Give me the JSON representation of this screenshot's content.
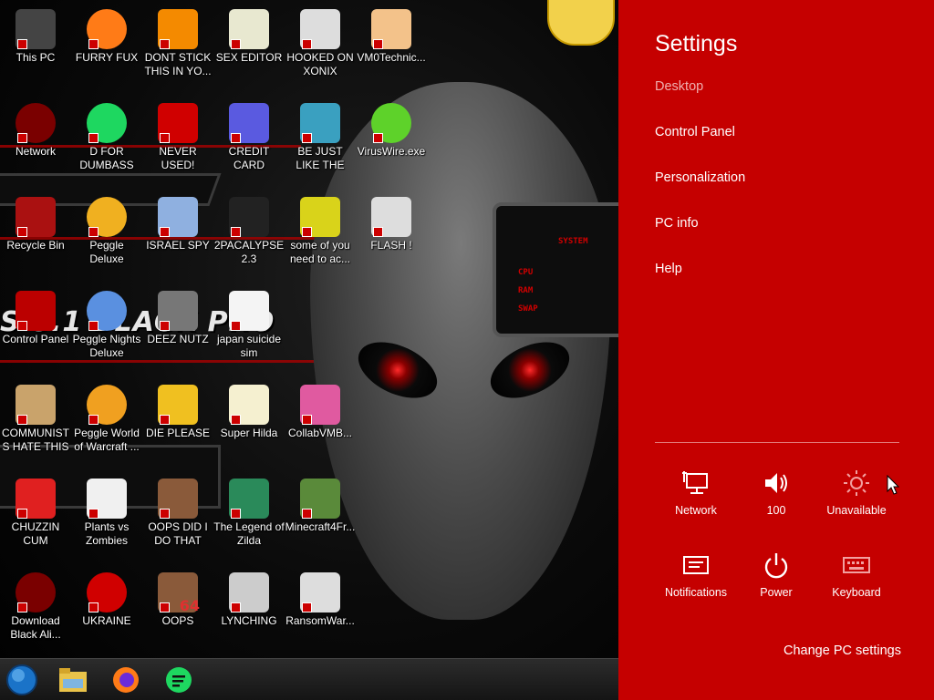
{
  "desktop": {
    "wallpaper_text": "S 8.1 BLACK PRO",
    "system_panel": {
      "title": "SYSTEM",
      "rows": [
        "CPU",
        "RAM",
        "SWAP"
      ]
    },
    "icons": [
      {
        "label": "This PC",
        "icon": "computer-icon"
      },
      {
        "label": "FURRY FUX",
        "icon": "firefox-icon"
      },
      {
        "label": "DONT STICK THIS IN YO...",
        "icon": "vlc-cone-icon"
      },
      {
        "label": "SEX EDITOR",
        "icon": "hex-editor-icon"
      },
      {
        "label": "HOOKED ON XONIX",
        "icon": "xonix-game-icon"
      },
      {
        "label": "VM0Technic...",
        "icon": "doctor-avatar-icon"
      },
      {
        "label": "Network",
        "icon": "network-orb-icon"
      },
      {
        "label": "D FOR DUMBASS",
        "icon": "spotify-icon"
      },
      {
        "label": "NEVER USED!",
        "icon": "devcpp-icon"
      },
      {
        "label": "CREDIT CARD CHECKER",
        "icon": "credit-card-icon"
      },
      {
        "label": "BE JUST LIKE THE DUDE!",
        "icon": "santa-dude-icon"
      },
      {
        "label": "VirusWire.exe",
        "icon": "limewire-icon"
      },
      {
        "label": "Recycle Bin",
        "icon": "recycle-bin-icon"
      },
      {
        "label": "Peggle Deluxe",
        "icon": "peggle-icon"
      },
      {
        "label": "ISRAEL SPY",
        "icon": "spy-program-icon"
      },
      {
        "label": "2PACALYPSE 2.3",
        "icon": "cmd-prompt-icon"
      },
      {
        "label": "some of you need to ac...",
        "icon": "dog-image-icon"
      },
      {
        "label": "FLASH !",
        "icon": "flash-icon"
      },
      {
        "label": "Control Panel",
        "icon": "control-panel-icon"
      },
      {
        "label": "Peggle Nights Deluxe",
        "icon": "peggle-nights-icon"
      },
      {
        "label": "DEEZ NUTZ",
        "icon": "stacked-windows-icon"
      },
      {
        "label": "japan suicide sim",
        "icon": "game-file-icon"
      },
      {
        "label": "COMMUNISTS HATE THIS G...",
        "icon": "money-bag-icon"
      },
      {
        "label": "Peggle World of Warcraft ...",
        "icon": "peggle-wow-icon"
      },
      {
        "label": "DIE PLEASE",
        "icon": "de-app-icon"
      },
      {
        "label": "Super Hilda",
        "icon": "pixel-game-icon"
      },
      {
        "label": "CollabVMB...",
        "icon": "collabvm-icon"
      },
      {
        "label": "CHUZZIN CUM",
        "icon": "chuzzle-icon"
      },
      {
        "label": "Plants vs Zombies",
        "icon": "pvz-flower-icon"
      },
      {
        "label": "OOPS DID I DO THAT",
        "icon": "portrait-icon"
      },
      {
        "label": "The Legend of Zilda",
        "icon": "zelda-sprite-icon"
      },
      {
        "label": "Minecraft4Fr...",
        "icon": "minecraft-block-icon"
      },
      {
        "label": "Download Black Ali...",
        "icon": "alienware-orb-icon"
      },
      {
        "label": "UKRAINE",
        "icon": "radiation-icon"
      },
      {
        "label": "OOPS",
        "icon": "portrait-64-icon",
        "badge": "64"
      },
      {
        "label": "LYNCHING",
        "icon": "lynch-knot-icon"
      },
      {
        "label": "RansomWar...",
        "icon": "skull-icon"
      }
    ]
  },
  "taskbar": {
    "items": [
      {
        "name": "start-orb",
        "icon": "start-orb-icon"
      },
      {
        "name": "file-explorer",
        "icon": "folder-icon"
      },
      {
        "name": "firefox",
        "icon": "firefox-icon"
      },
      {
        "name": "spotify-green",
        "icon": "green-chat-icon"
      }
    ]
  },
  "settings": {
    "title": "Settings",
    "context": "Desktop",
    "links": [
      "Control Panel",
      "Personalization",
      "PC info",
      "Help"
    ],
    "quick": [
      {
        "label": "Network",
        "icon": "network-monitor-icon"
      },
      {
        "label": "100",
        "icon": "volume-icon"
      },
      {
        "label": "Unavailable",
        "icon": "brightness-icon"
      },
      {
        "label": "Notifications",
        "icon": "notifications-icon"
      },
      {
        "label": "Power",
        "icon": "power-icon"
      },
      {
        "label": "Keyboard",
        "icon": "keyboard-icon"
      }
    ],
    "change_pc_settings": "Change PC settings",
    "accent_color": "#c50000"
  }
}
